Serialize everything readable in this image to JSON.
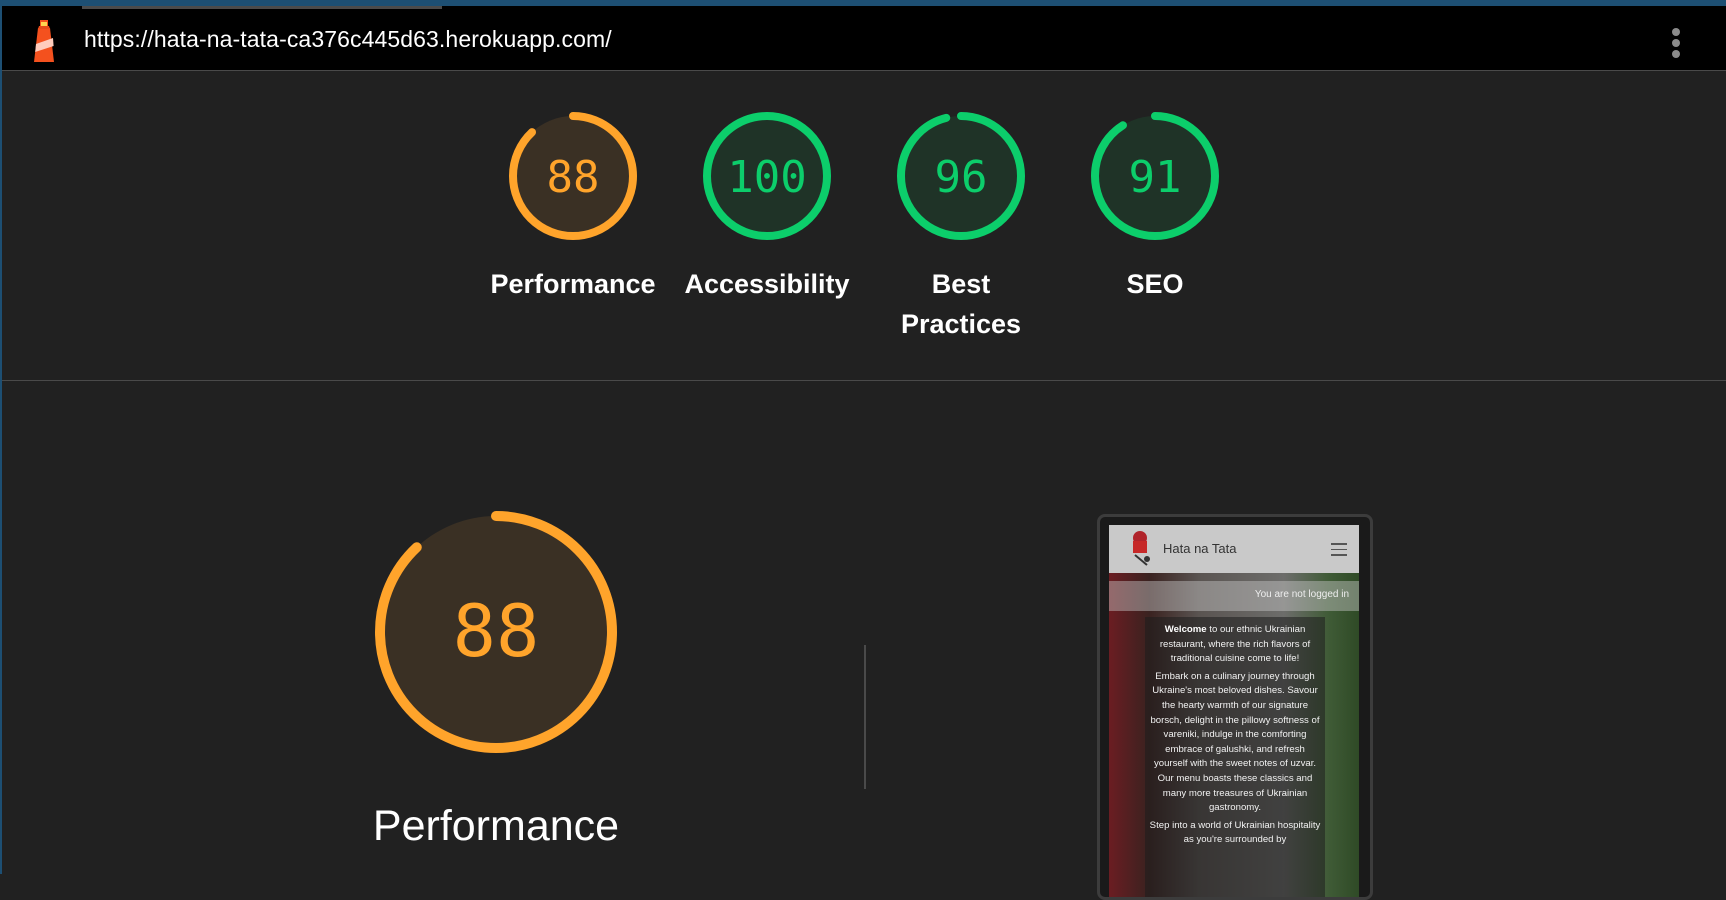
{
  "topbar": {
    "url": "https://hata-na-tata-ca376c445d63.herokuapp.com/",
    "logo_icon": "lighthouse-icon",
    "menu_icon": "kebab-menu-icon"
  },
  "colors": {
    "average": "#ffa42b",
    "pass": "#0cce6b",
    "background": "#212121"
  },
  "scores": [
    {
      "label": "Performance",
      "value": 88,
      "status": "average"
    },
    {
      "label": "Accessibility",
      "value": 100,
      "status": "pass"
    },
    {
      "label": "Best Practices",
      "value": 96,
      "status": "pass"
    },
    {
      "label": "SEO",
      "value": 91,
      "status": "pass"
    }
  ],
  "main": {
    "score": 88,
    "label": "Performance"
  },
  "screenshot": {
    "site_title": "Hata na Tata",
    "login_status": "You are not logged in",
    "welcome_bold": "Welcome",
    "welcome_rest": " to our ethnic Ukrainian restaurant, where the rich flavors of traditional cuisine come to life!",
    "para2": "Embark on a culinary journey through Ukraine's most beloved dishes. Savour the hearty warmth of our signature borsch, delight in the pillowy softness of vareniki, indulge in the comforting embrace of galushki, and refresh yourself with the sweet notes of uzvar. Our menu boasts these classics and many more treasures of Ukrainian gastronomy.",
    "para3": "Step into a world of Ukrainian hospitality as you're surrounded by"
  }
}
